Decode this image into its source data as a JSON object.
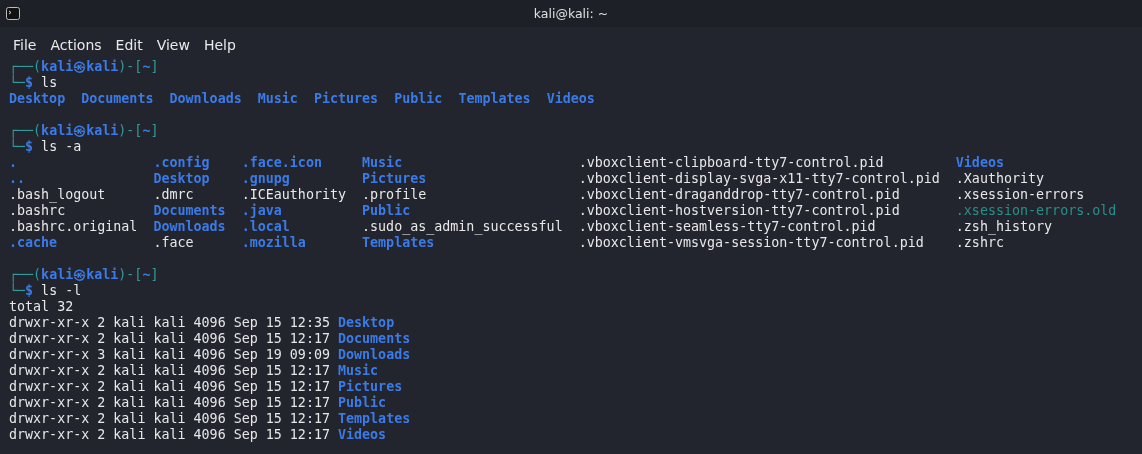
{
  "window": {
    "title": "kali@kali: ~"
  },
  "menu": [
    {
      "label": "File"
    },
    {
      "label": "Actions"
    },
    {
      "label": "Edit"
    },
    {
      "label": "View"
    },
    {
      "label": "Help"
    }
  ],
  "terminal": {
    "blocks": [
      {
        "prompt": {
          "open": "┌──(",
          "user_host": "kali㉿kali",
          "sep": ")-[",
          "path": "~",
          "close": "]",
          "corner": "└─",
          "symbol": "$"
        },
        "command": "ls",
        "output": {
          "kind": "row",
          "items": [
            {
              "name": "Desktop",
              "kind": "dir"
            },
            {
              "name": "Documents",
              "kind": "dir"
            },
            {
              "name": "Downloads",
              "kind": "dir"
            },
            {
              "name": "Music",
              "kind": "dir"
            },
            {
              "name": "Pictures",
              "kind": "dir"
            },
            {
              "name": "Public",
              "kind": "dir"
            },
            {
              "name": "Templates",
              "kind": "dir"
            },
            {
              "name": "Videos",
              "kind": "dir"
            }
          ]
        }
      },
      {
        "prompt": {
          "open": "┌──(",
          "user_host": "kali㉿kali",
          "sep": ")-[",
          "path": "~",
          "close": "]",
          "corner": "└─",
          "symbol": "$"
        },
        "command": "ls -a",
        "output": {
          "kind": "columns",
          "rows": [
            [
              {
                "name": ".",
                "kind": "dir"
              },
              {
                "name": ".config",
                "kind": "dir"
              },
              {
                "name": ".face.icon",
                "kind": "dir"
              },
              {
                "name": "Music",
                "kind": "dir"
              },
              {
                "name": ".vboxclient-clipboard-tty7-control.pid",
                "kind": "file"
              },
              {
                "name": "Videos",
                "kind": "dir"
              }
            ],
            [
              {
                "name": "..",
                "kind": "dir"
              },
              {
                "name": "Desktop",
                "kind": "dir"
              },
              {
                "name": ".gnupg",
                "kind": "dir"
              },
              {
                "name": "Pictures",
                "kind": "dir"
              },
              {
                "name": ".vboxclient-display-svga-x11-tty7-control.pid",
                "kind": "file"
              },
              {
                "name": ".Xauthority",
                "kind": "file"
              }
            ],
            [
              {
                "name": ".bash_logout",
                "kind": "file"
              },
              {
                "name": ".dmrc",
                "kind": "file"
              },
              {
                "name": ".ICEauthority",
                "kind": "file"
              },
              {
                "name": ".profile",
                "kind": "file"
              },
              {
                "name": ".vboxclient-draganddrop-tty7-control.pid",
                "kind": "file"
              },
              {
                "name": ".xsession-errors",
                "kind": "file"
              }
            ],
            [
              {
                "name": ".bashrc",
                "kind": "file"
              },
              {
                "name": "Documents",
                "kind": "dir"
              },
              {
                "name": ".java",
                "kind": "dir"
              },
              {
                "name": "Public",
                "kind": "dir"
              },
              {
                "name": ".vboxclient-hostversion-tty7-control.pid",
                "kind": "file"
              },
              {
                "name": ".xsession-errors.old",
                "kind": "special"
              }
            ],
            [
              {
                "name": ".bashrc.original",
                "kind": "file"
              },
              {
                "name": "Downloads",
                "kind": "dir"
              },
              {
                "name": ".local",
                "kind": "dir"
              },
              {
                "name": ".sudo_as_admin_successful",
                "kind": "file"
              },
              {
                "name": ".vboxclient-seamless-tty7-control.pid",
                "kind": "file"
              },
              {
                "name": ".zsh_history",
                "kind": "file"
              }
            ],
            [
              {
                "name": ".cache",
                "kind": "dir"
              },
              {
                "name": ".face",
                "kind": "file"
              },
              {
                "name": ".mozilla",
                "kind": "dir"
              },
              {
                "name": "Templates",
                "kind": "dir"
              },
              {
                "name": ".vboxclient-vmsvga-session-tty7-control.pid",
                "kind": "file"
              },
              {
                "name": ".zshrc",
                "kind": "file"
              }
            ]
          ]
        }
      },
      {
        "prompt": {
          "open": "┌──(",
          "user_host": "kali㉿kali",
          "sep": ")-[",
          "path": "~",
          "close": "]",
          "corner": "└─",
          "symbol": "$"
        },
        "command": "ls -l",
        "output": {
          "kind": "long",
          "total": "total 32",
          "lines": [
            {
              "meta": "drwxr-xr-x 2 kali kali 4096 Sep 15 12:35",
              "name": "Desktop",
              "kind": "dir"
            },
            {
              "meta": "drwxr-xr-x 2 kali kali 4096 Sep 15 12:17",
              "name": "Documents",
              "kind": "dir"
            },
            {
              "meta": "drwxr-xr-x 3 kali kali 4096 Sep 19 09:09",
              "name": "Downloads",
              "kind": "dir"
            },
            {
              "meta": "drwxr-xr-x 2 kali kali 4096 Sep 15 12:17",
              "name": "Music",
              "kind": "dir"
            },
            {
              "meta": "drwxr-xr-x 2 kali kali 4096 Sep 15 12:17",
              "name": "Pictures",
              "kind": "dir"
            },
            {
              "meta": "drwxr-xr-x 2 kali kali 4096 Sep 15 12:17",
              "name": "Public",
              "kind": "dir"
            },
            {
              "meta": "drwxr-xr-x 2 kali kali 4096 Sep 15 12:17",
              "name": "Templates",
              "kind": "dir"
            },
            {
              "meta": "drwxr-xr-x 2 kali kali 4096 Sep 15 12:17",
              "name": "Videos",
              "kind": "dir"
            }
          ]
        }
      }
    ]
  }
}
